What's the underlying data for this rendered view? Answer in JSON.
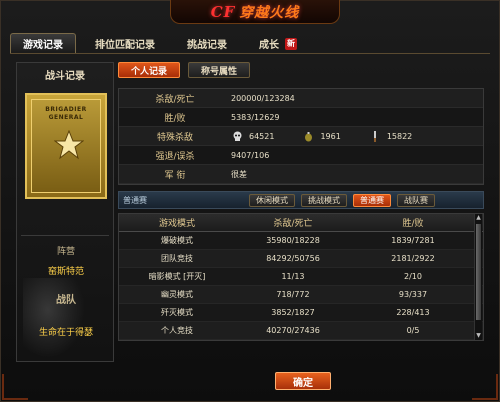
{
  "logo": {
    "brand": "CF",
    "title": "穿越火线"
  },
  "tabs": [
    {
      "label": "游戏记录",
      "active": true
    },
    {
      "label": "排位匹配记录",
      "active": false
    },
    {
      "label": "挑战记录",
      "active": false
    },
    {
      "label": "成长",
      "active": false
    }
  ],
  "new_badge": "新",
  "sidebar": {
    "title": "战斗记录",
    "rank_line1": "BRIGADIER",
    "rank_line2": "GENERAL",
    "emblem_label": "阵营",
    "emblem_value": "窑斯特范",
    "clan_label": "战队",
    "clan_value": "生命在于得瑟"
  },
  "subtabs": [
    {
      "label": "个人记录",
      "active": true
    },
    {
      "label": "称号属性",
      "active": false
    }
  ],
  "stats": {
    "kd_label": "杀敌/死亡",
    "kd_value": "200000/123284",
    "wl_label": "胜/败",
    "wl_value": "5383/12629",
    "special_label": "特殊杀敌",
    "special": [
      {
        "icon": "skull-icon",
        "value": "64521"
      },
      {
        "icon": "grenade-icon",
        "value": "1961"
      },
      {
        "icon": "knife-icon",
        "value": "15822"
      }
    ],
    "escape_label": "强退/误杀",
    "escape_value": "9407/106",
    "rank_label": "军 衔",
    "rank_value": "很差"
  },
  "filter": {
    "title": "普通赛",
    "buttons": [
      {
        "label": "休闲模式",
        "active": false
      },
      {
        "label": "挑战模式",
        "active": false
      },
      {
        "label": "普通赛",
        "active": true
      },
      {
        "label": "战队赛",
        "active": false
      }
    ]
  },
  "table": {
    "headers": [
      "游戏模式",
      "杀敌/死亡",
      "胜/败"
    ],
    "rows": [
      [
        "爆破模式",
        "35980/18228",
        "1839/7281"
      ],
      [
        "团队竞技",
        "84292/50756",
        "2181/2922"
      ],
      [
        "暗影模式 [开灭]",
        "11/13",
        "2/10"
      ],
      [
        "幽灵模式",
        "718/772",
        "93/337"
      ],
      [
        "歼灭模式",
        "3852/1827",
        "228/413"
      ],
      [
        "个人竞技",
        "40270/27436",
        "0/5"
      ]
    ]
  },
  "confirm_label": "确定",
  "colors": {
    "accent": "#e0561a",
    "gold": "#ffd24a"
  }
}
